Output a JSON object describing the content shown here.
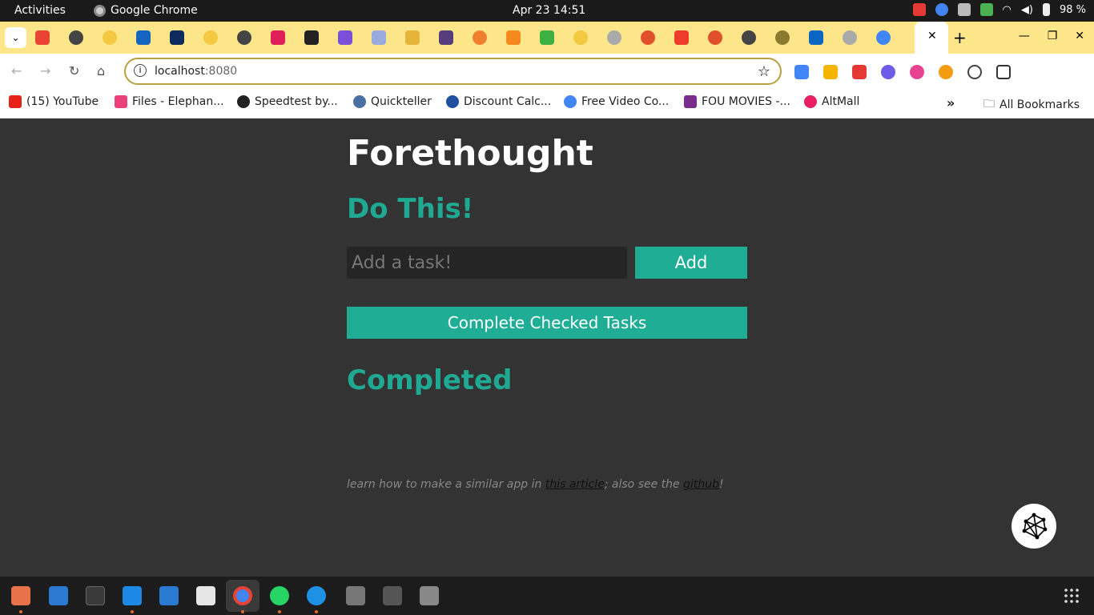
{
  "system": {
    "activities": "Activities",
    "app_name": "Google Chrome",
    "clock": "Apr 23  14:51",
    "battery": "98 %"
  },
  "browser": {
    "close_tab": "✕",
    "new_tab": "+",
    "url_host": "localhost",
    "url_port": ":8080",
    "bookmarks": [
      {
        "label": "(15) YouTube",
        "color": "#e62117"
      },
      {
        "label": "Files - Elephan...",
        "color": "#ec407a"
      },
      {
        "label": "Speedtest by...",
        "color": "#222222"
      },
      {
        "label": "Quickteller",
        "color": "#4a6fa5"
      },
      {
        "label": "Discount Calc...",
        "color": "#1e4fa0"
      },
      {
        "label": "Free Video Co...",
        "color": "#4285f4"
      },
      {
        "label": "FOU MOVIES -...",
        "color": "#7b2d8e"
      },
      {
        "label": "AltMall",
        "color": "#e91e63"
      }
    ],
    "more_bookmarks": "»",
    "all_bookmarks": "All Bookmarks"
  },
  "app": {
    "title": "Forethought",
    "todo_heading": "Do This!",
    "input_placeholder": "Add a task!",
    "add_label": "Add",
    "complete_label": "Complete Checked Tasks",
    "completed_heading": "Completed",
    "footer_prefix": "learn how to make a similar app in ",
    "footer_link1": "this article",
    "footer_mid": "; also see the ",
    "footer_link2": "github",
    "footer_suffix": "!"
  },
  "colors": {
    "accent": "#1fae95",
    "background": "#333333",
    "tabbar": "#fde68a"
  }
}
